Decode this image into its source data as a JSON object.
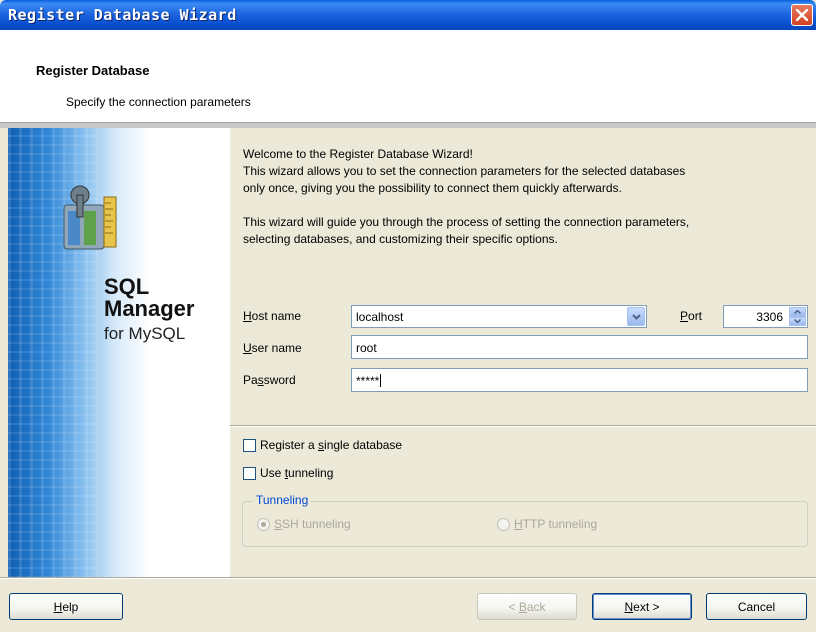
{
  "window": {
    "title": "Register Database Wizard"
  },
  "header": {
    "title": "Register Database",
    "subtitle": "Specify the connection parameters"
  },
  "banner": {
    "product_line1": "SQL",
    "product_line2": "Manager",
    "product_line3": "for MySQL"
  },
  "intro": {
    "line1": "Welcome to the Register Database Wizard!",
    "line2": "This wizard allows you to set the connection parameters for the selected databases",
    "line3": "only once, giving you the possibility to connect them quickly afterwards.",
    "line4": "This wizard will guide you through the process of setting the connection parameters,",
    "line5": "selecting databases, and customizing their specific options."
  },
  "form": {
    "host_label_u": "H",
    "host_label_rest": "ost name",
    "host_value": "localhost",
    "port_label_u": "P",
    "port_label_rest": "ort",
    "port_value": "3306",
    "user_label_u": "U",
    "user_label_rest": "ser name",
    "user_value": "root",
    "pass_label_pre": "Pa",
    "pass_label_u": "s",
    "pass_label_rest": "sword",
    "pass_value": "*****"
  },
  "options": {
    "single_db_pre": "Register a ",
    "single_db_u": "s",
    "single_db_rest": "ingle database",
    "tunnel_pre": "Use ",
    "tunnel_u": "t",
    "tunnel_rest": "unneling",
    "tunneling_group": "Tunneling",
    "ssh_u": "S",
    "ssh_rest": "SH tunneling",
    "http_u": "H",
    "http_rest": "TTP tunneling"
  },
  "buttons": {
    "help_u": "H",
    "help_rest": "elp",
    "back_pre": "< ",
    "back_u": "B",
    "back_rest": "ack",
    "next_u": "N",
    "next_rest": "ext >",
    "cancel": "Cancel"
  }
}
